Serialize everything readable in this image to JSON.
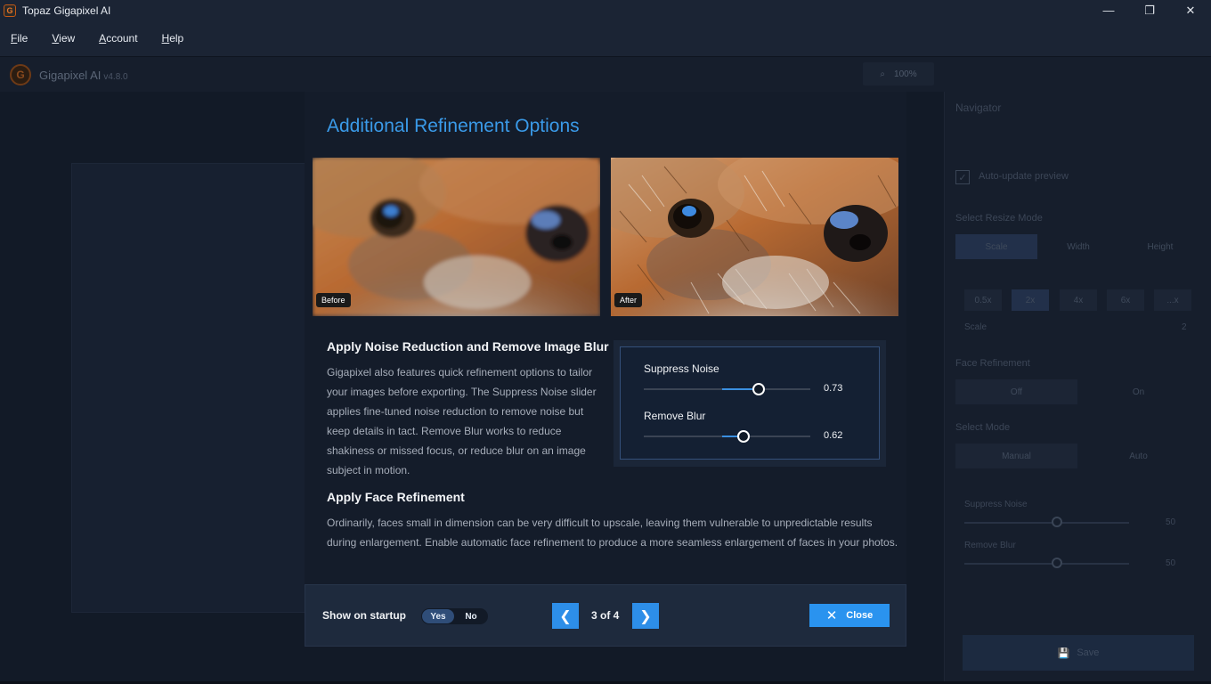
{
  "window": {
    "title": "Topaz Gigapixel AI",
    "controls": {
      "minimize": "—",
      "restore": "❐",
      "close": "✕"
    }
  },
  "menu": [
    "File",
    "View",
    "Account",
    "Help"
  ],
  "app_header": {
    "name": "Gigapixel AI",
    "version": "v4.8.0",
    "zoom": "100%"
  },
  "right_panel": {
    "navigator": "Navigator",
    "auto_update": "Auto-update preview",
    "resize_mode_label": "Select Resize Mode",
    "resize_modes": [
      "Scale",
      "Width",
      "Height"
    ],
    "scale_options": [
      "0.5x",
      "2x",
      "4x",
      "6x",
      "...x"
    ],
    "scale_label": "Scale",
    "scale_value": "2",
    "face_refinement_label": "Face Refinement",
    "face_options": [
      "Off",
      "On"
    ],
    "mode_label": "Select Mode",
    "mode_options": [
      "Manual",
      "Auto"
    ],
    "suppress_noise_label": "Suppress Noise",
    "suppress_noise_value": "50",
    "remove_blur_label": "Remove Blur",
    "remove_blur_value": "50",
    "save_label": "Save"
  },
  "dialog": {
    "title": "Additional Refinement Options",
    "before_tag": "Before",
    "after_tag": "After",
    "section1_heading": "Apply Noise Reduction and Remove Image Blur",
    "section1_lines": [
      "Gigapixel also features quick refinement options to tailor",
      "your images before exporting. The Suppress Noise slider",
      "applies fine-tuned noise reduction to remove noise but",
      "keep details in tact. Remove Blur works to reduce",
      "shakiness or missed focus, or reduce blur on an image",
      "subject in motion."
    ],
    "section2_heading": "Apply Face Refinement",
    "section2_lines": [
      "Ordinarily, faces small in dimension can be very difficult to upscale, leaving them vulnerable to unpredictable results",
      "during enlargement. Enable automatic face refinement to produce a more seamless enlargement of faces in your photos."
    ],
    "sliders": [
      {
        "label": "Suppress Noise",
        "value": "0.73",
        "level": 0.69
      },
      {
        "label": "Remove Blur",
        "value": "0.62",
        "level": 0.6
      }
    ],
    "footer": {
      "show_on_startup": "Show on startup",
      "yes": "Yes",
      "no": "No",
      "page": "3 of 4",
      "close": "Close"
    }
  }
}
